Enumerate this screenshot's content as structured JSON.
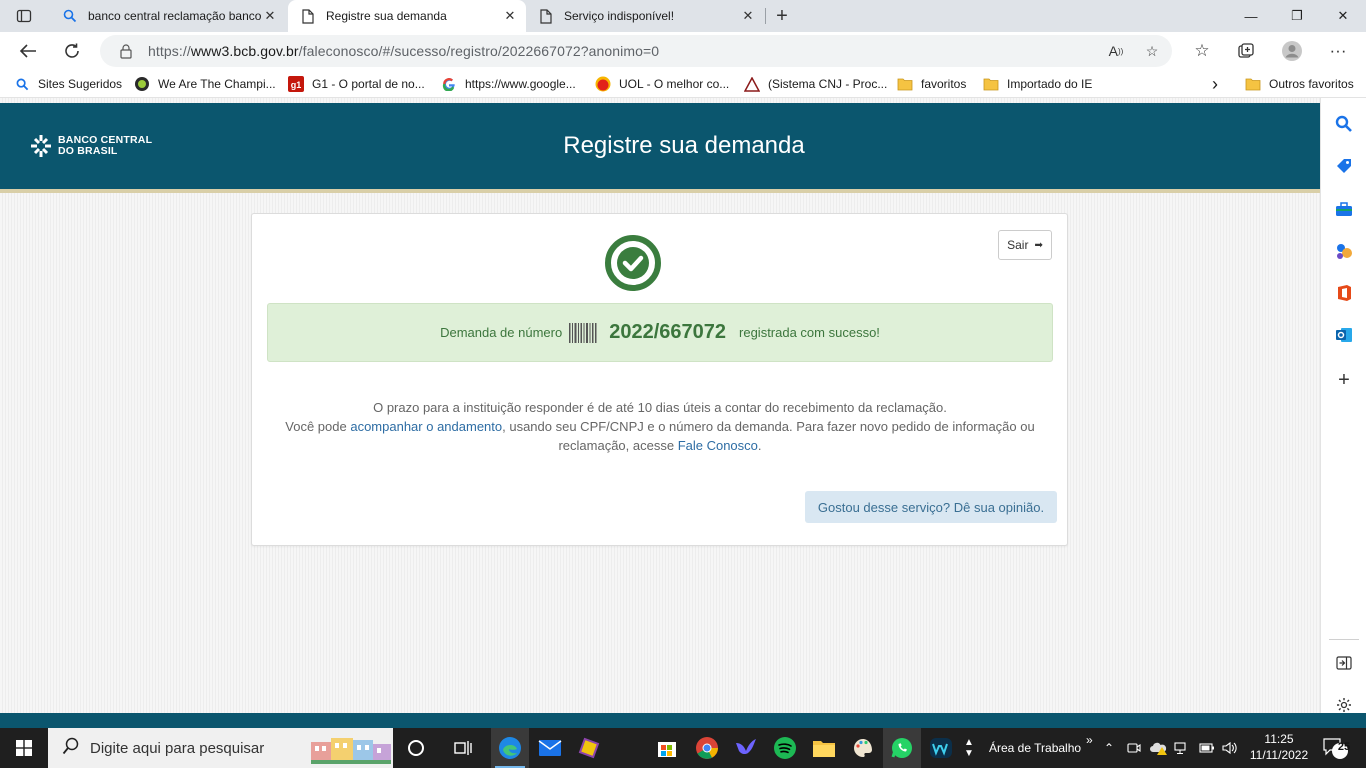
{
  "browser": {
    "tabs": [
      {
        "label": "banco central reclamação banco",
        "icon": "search-icon",
        "active": false
      },
      {
        "label": "Registre sua demanda",
        "icon": "page-icon",
        "active": true
      },
      {
        "label": "Serviço indisponível!",
        "icon": "page-icon",
        "active": false
      }
    ],
    "tab_close_glyph": "✕",
    "new_tab_glyph": "+",
    "window_controls": {
      "minimize": "—",
      "restore": "❐",
      "close": "✕"
    },
    "address": {
      "prefix": "https://",
      "host": "www3.bcb.gov.br",
      "path": "/faleconosco/#/sucesso/registro/2022667072?anonimo=0"
    },
    "favorites": [
      {
        "label": "Sites Sugeridos",
        "icon": "search-icon"
      },
      {
        "label": "We Are The Champi...",
        "icon": "lime-icon"
      },
      {
        "label": "G1 - O portal de no...",
        "icon": "g1-icon"
      },
      {
        "label": "https://www.google...",
        "icon": "google-icon"
      },
      {
        "label": "UOL - O melhor co...",
        "icon": "uol-icon"
      },
      {
        "label": "(Sistema CNJ - Proc...",
        "icon": "triangle-icon"
      },
      {
        "label": "favoritos",
        "icon": "folder-icon"
      },
      {
        "label": "Importado do IE",
        "icon": "folder-icon"
      },
      {
        "label": "Outros favoritos",
        "icon": "folder-icon"
      }
    ],
    "favorites_more_glyph": "›"
  },
  "site": {
    "logo_line1": "BANCO CENTRAL",
    "logo_line2": "DO BRASIL",
    "title": "Registre sua demanda"
  },
  "card": {
    "exit_label": "Sair",
    "success_prefix": "Demanda de número",
    "demand_number": "2022/667072",
    "success_suffix": "registrada com sucesso!",
    "info_line1": "O prazo para a instituição responder é de até 10 dias úteis a contar do recebimento da reclamação.",
    "info_line2_a": "Você pode ",
    "info_link1": "acompanhar o andamento",
    "info_line2_b": ", usando seu CPF/CNPJ e o número da demanda. Para fazer novo pedido de informação ou reclamação, acesse ",
    "info_link2": "Fale Conosco",
    "info_line2_c": ".",
    "feedback_label": "Gostou desse serviço? Dê sua opinião."
  },
  "taskbar": {
    "search_placeholder": "Digite aqui para pesquisar",
    "desktop_label": "Área de Trabalho",
    "chevron": "»",
    "time": "11:25",
    "date": "11/11/2022",
    "notification_count": "25"
  },
  "colors": {
    "header": "#0b566e",
    "success_bg": "#dff0d8",
    "success_text": "#3c763d",
    "link": "#2e6da4",
    "check": "#3a7d3e"
  }
}
